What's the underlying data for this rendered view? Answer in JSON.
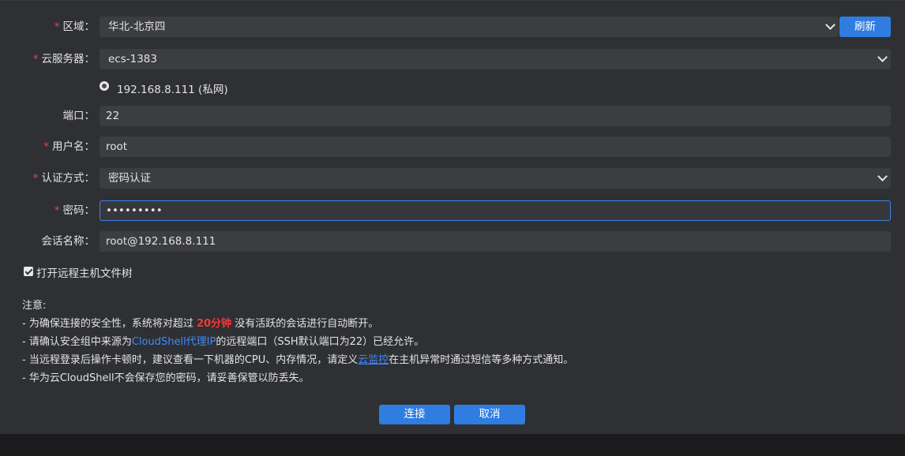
{
  "form": {
    "region": {
      "label": "区域：",
      "value": "华北-北京四",
      "refresh_label": "刷新"
    },
    "server": {
      "label": "云服务器：",
      "value": "ecs-1383"
    },
    "ip_option": "192.168.8.111 (私网)",
    "port": {
      "label": "端口：",
      "value": "22"
    },
    "username": {
      "label": "用户名：",
      "value": "root"
    },
    "auth": {
      "label": "认证方式：",
      "value": "密码认证"
    },
    "password": {
      "label": "密码：",
      "value": "•••••••••"
    },
    "session": {
      "label": "会话名称：",
      "value": "root@192.168.8.111"
    },
    "required_mark": "*",
    "file_tree_label": "打开远程主机文件树",
    "file_tree_checked": true
  },
  "notes": {
    "title": "注意:",
    "line1_a": "- 为确保连接的安全性，系统将对超过 ",
    "line1_highlight": "20分钟",
    "line1_b": " 没有活跃的会话进行自动断开。",
    "line2_a": "- 请确认安全组中来源为",
    "line2_link": "CloudShell代理IP",
    "line2_b": "的远程端口（SSH默认端口为22）已经允许。",
    "line3_a": "- 当远程登录后操作卡顿时，建议查看一下机器的CPU、内存情况，请定义",
    "line3_link": "云监控",
    "line3_b": "在主机异常时通过短信等多种方式通知。",
    "line4": "- 华为云CloudShell不会保存您的密码，请妥善保管以防丢失。"
  },
  "buttons": {
    "connect": "连接",
    "cancel": "取消"
  },
  "colors": {
    "accent": "#2f7de0",
    "required": "#f0414a",
    "highlight": "#ff3535",
    "link": "#3d8bff"
  }
}
